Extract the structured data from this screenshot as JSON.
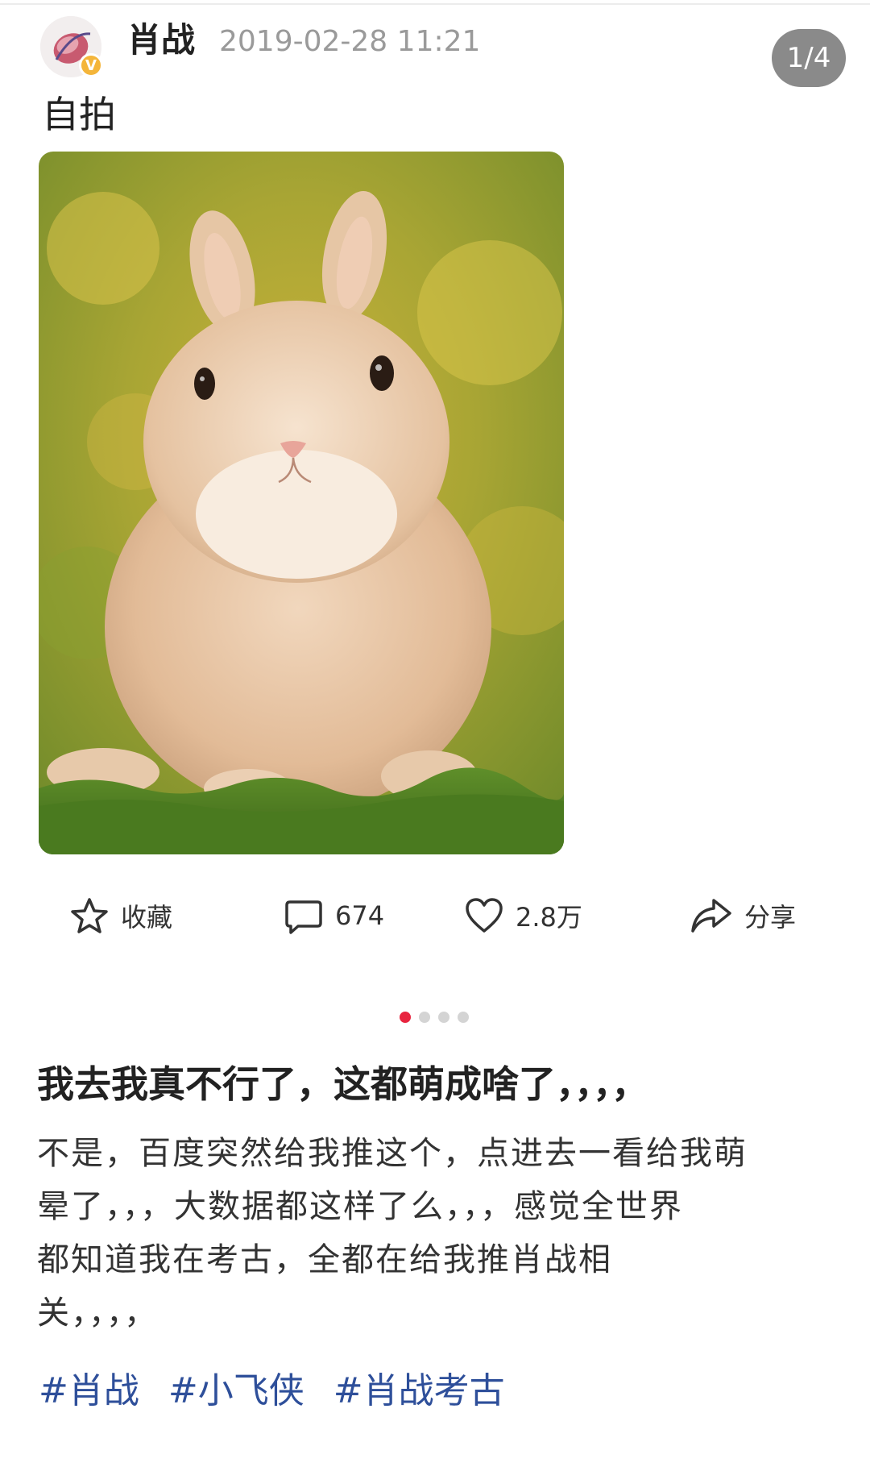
{
  "post": {
    "username": "肖战",
    "timestamp": "2019-02-28 11:21",
    "caption": "自拍",
    "verified_badge": "V",
    "page_indicator": "1/4",
    "image_description_icon": "bunny-photo"
  },
  "actions": {
    "favorite_label": "收藏",
    "comment_count": "674",
    "like_count": "2.8万",
    "share_label": "分享"
  },
  "pager": {
    "total": 4,
    "active_index": 0
  },
  "content": {
    "title": "我去我真不行了，这都萌成啥了，，，，",
    "body_lines": [
      "不是，百度突然给我推这个，点进去一看给我萌",
      "晕了，，，大数据都这样了么，，，感觉全世界",
      "都知道我在考古，全都在给我推肖战相",
      "关，，，，"
    ],
    "tags": [
      "#肖战",
      "#小飞侠",
      "#肖战考古"
    ]
  },
  "colors": {
    "accent_red": "#e8243f",
    "tag_blue": "#2e4f9a",
    "muted_gray": "#9a9a9a"
  }
}
